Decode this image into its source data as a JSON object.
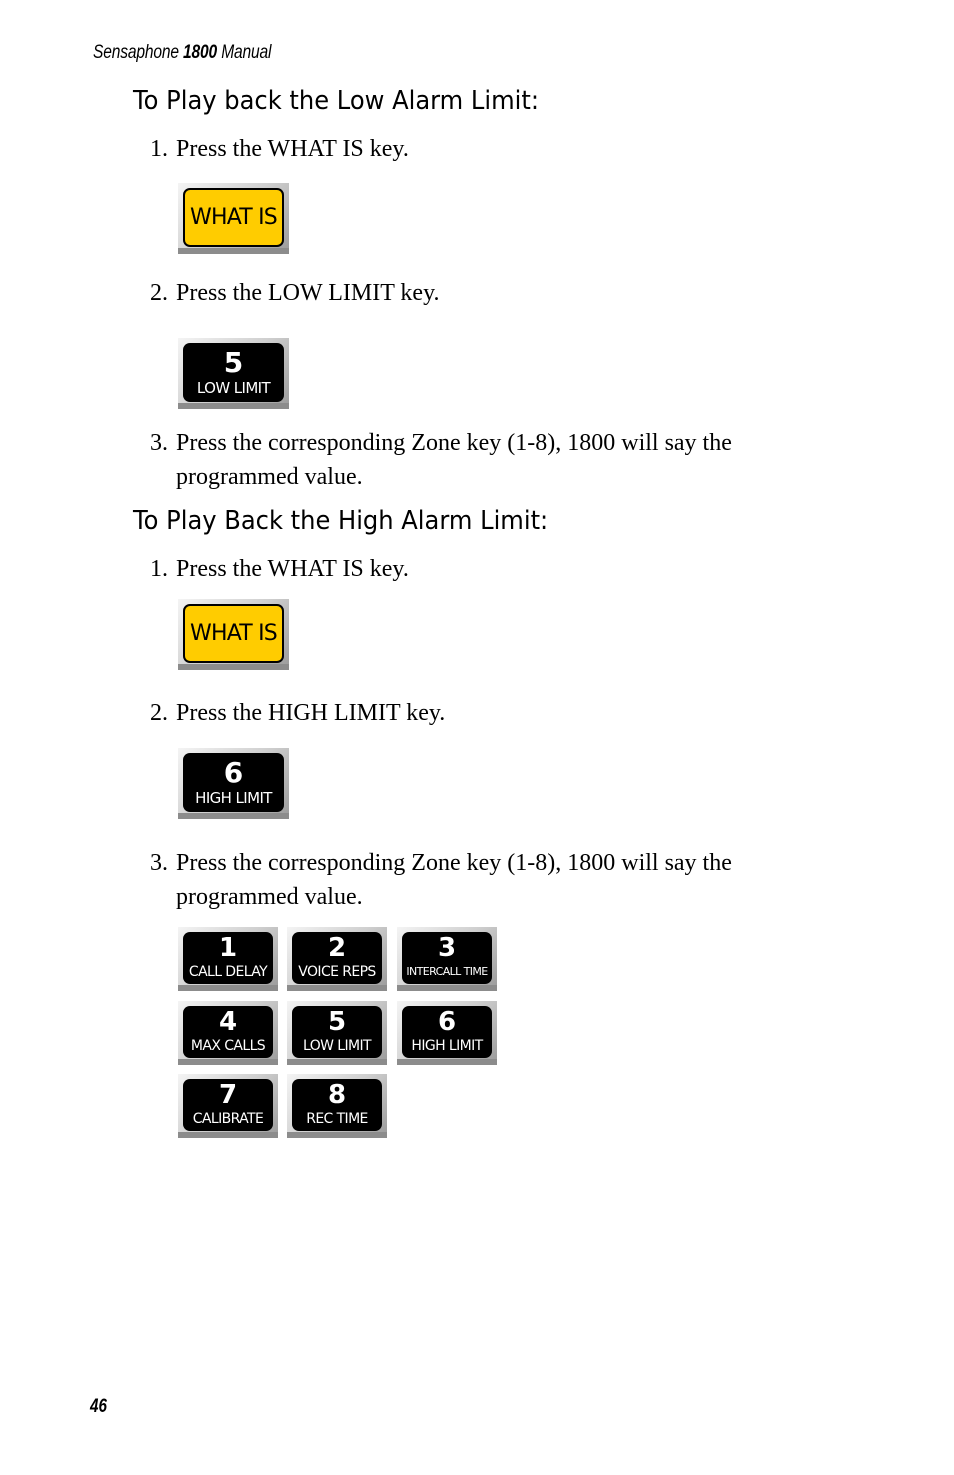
{
  "header": {
    "brand": "Sensaphone",
    "model": "1800",
    "suffix": "Manual"
  },
  "sections": [
    {
      "heading": "To Play back the Low Alarm Limit:",
      "steps": [
        {
          "num": "1.",
          "text": "Press the WHAT IS key."
        },
        {
          "num": "2.",
          "text": "Press the LOW LIMIT key."
        },
        {
          "num": "3.",
          "text": "Press the corresponding Zone key (1-8), 1800 will say the",
          "cont": "programmed value."
        }
      ],
      "keys": [
        {
          "type": "yellow",
          "label": "WHAT IS"
        },
        {
          "type": "black",
          "digit": "5",
          "label": "LOW LIMIT"
        }
      ]
    },
    {
      "heading": "To Play Back the High Alarm Limit:",
      "steps": [
        {
          "num": "1.",
          "text": "Press the WHAT IS key."
        },
        {
          "num": "2.",
          "text": "Press the HIGH LIMIT key."
        },
        {
          "num": "3.",
          "text": "Press the corresponding Zone key (1-8), 1800 will say the",
          "cont": "programmed value."
        }
      ],
      "keys": [
        {
          "type": "yellow",
          "label": "WHAT IS"
        },
        {
          "type": "black",
          "digit": "6",
          "label": "HIGH LIMIT"
        }
      ]
    }
  ],
  "keypad": [
    {
      "digit": "1",
      "label": "CALL DELAY"
    },
    {
      "digit": "2",
      "label": "VOICE REPS"
    },
    {
      "digit": "3",
      "label": "INTERCALL TIME"
    },
    {
      "digit": "4",
      "label": "MAX CALLS"
    },
    {
      "digit": "5",
      "label": "LOW LIMIT"
    },
    {
      "digit": "6",
      "label": "HIGH LIMIT"
    },
    {
      "digit": "7",
      "label": "CALIBRATE"
    },
    {
      "digit": "8",
      "label": "REC TIME"
    }
  ],
  "colors": {
    "what_is_key": "#ffcc00",
    "zone_key": "#000000"
  },
  "page_number": "46"
}
